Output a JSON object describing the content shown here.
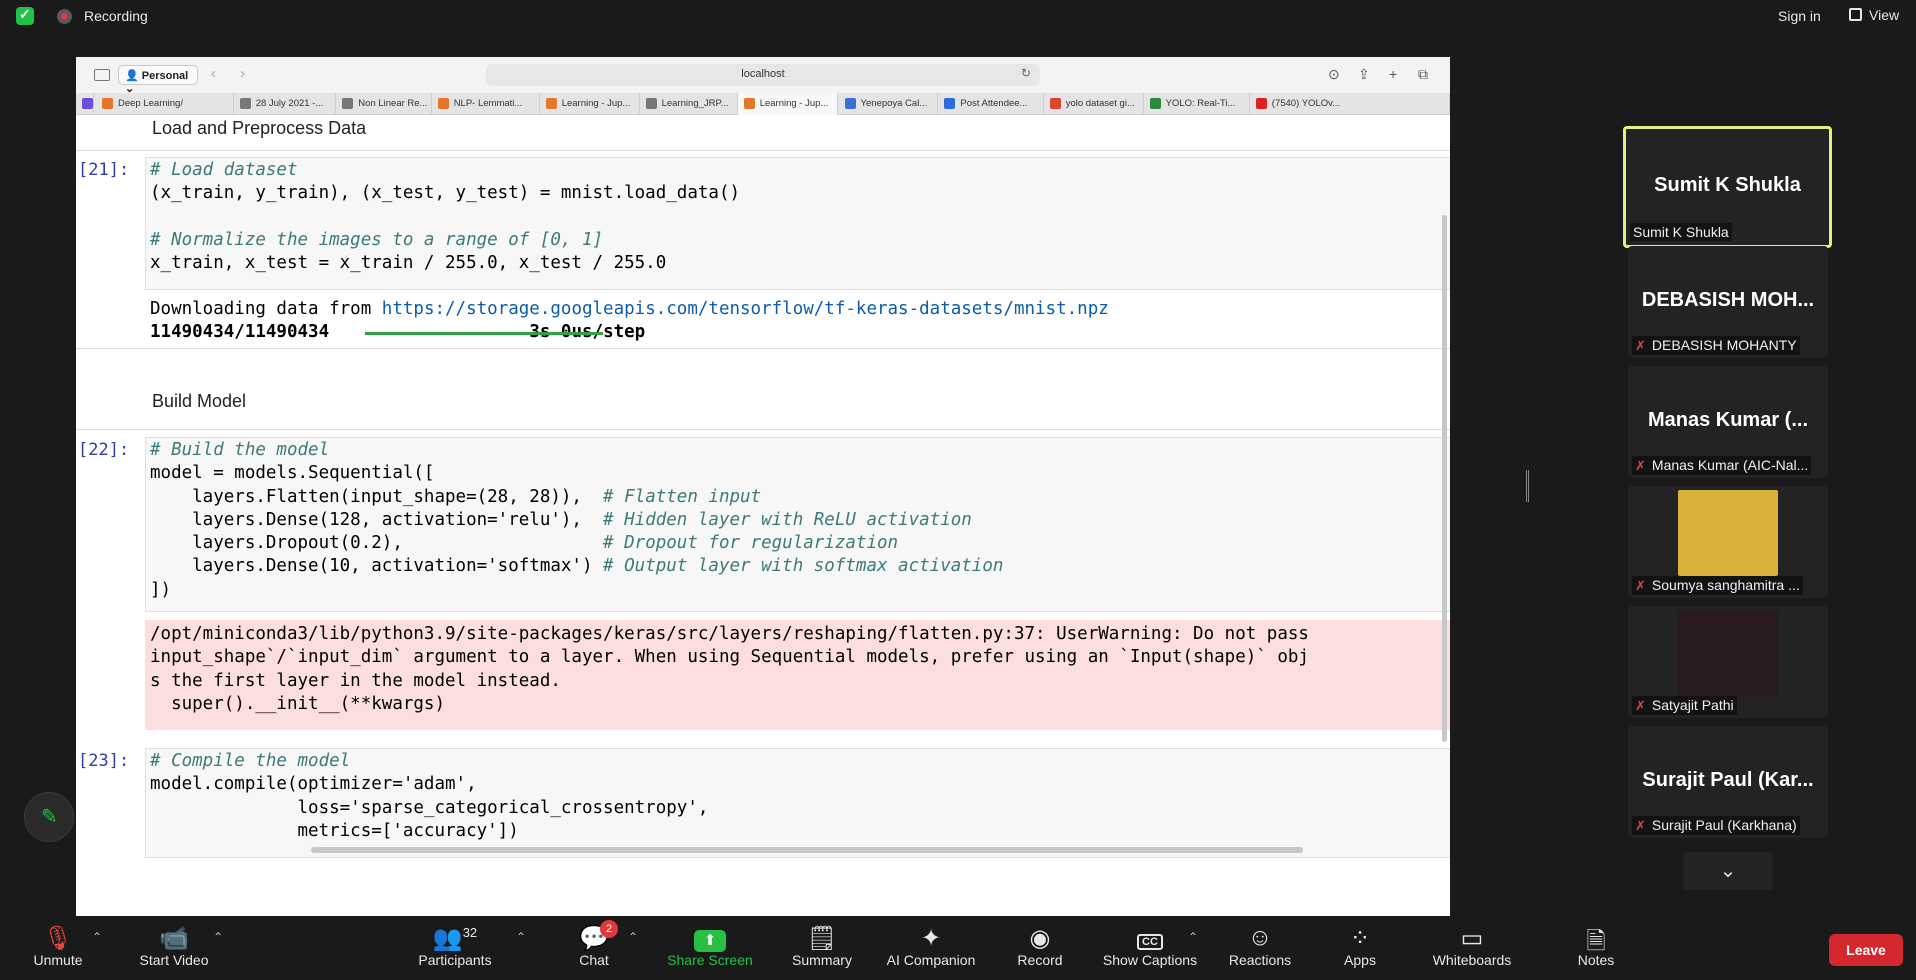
{
  "topbar": {
    "recording_label": "Recording",
    "sign_in": "Sign in",
    "view": "View"
  },
  "browser": {
    "profile": "Personal",
    "url": "localhost",
    "tabs": [
      {
        "label": "Deep Learning/",
        "color": "#e3772a"
      },
      {
        "label": "28 July 2021 -...",
        "color": "#777"
      },
      {
        "label": "Non Linear Re...",
        "color": "#777"
      },
      {
        "label": "NLP- Lemmati...",
        "color": "#e3772a"
      },
      {
        "label": "Learning - Jup...",
        "color": "#e3772a"
      },
      {
        "label": "Learning_JRP...",
        "color": "#777"
      },
      {
        "label": "Learning - Jup...",
        "color": "#e3772a"
      },
      {
        "label": "Yenepoya Cal...",
        "color": "#3a6fd8"
      },
      {
        "label": "Post Attendee...",
        "color": "#2b6de0"
      },
      {
        "label": "yolo dataset gi...",
        "color": "#dd4433"
      },
      {
        "label": "YOLO: Real-Ti...",
        "color": "#2a8a3a"
      },
      {
        "label": "(7540) YOLOv...",
        "color": "#e02020"
      }
    ]
  },
  "notebook": {
    "heading1": "Load and Preprocess Data",
    "cell21_prompt": "[21]:",
    "cell21_line1": "# Load dataset",
    "cell21_line2": "(x_train, y_train), (x_test, y_test) = mnist.load_data()",
    "cell21_line3": "# Normalize the images to a range of [0, 1]",
    "cell21_line4": "x_train, x_test = x_train / 255.0, x_test / 255.0",
    "cell21_out1_prefix": "Downloading data from ",
    "cell21_out1_link": "https://storage.googleapis.com/tensorflow/tf-keras-datasets/mnist.npz",
    "cell21_out2_count": "11490434/11490434",
    "cell21_out2_time": "3s 0us/step",
    "cell21_progress": 1.0,
    "heading2": "Build Model",
    "cell22_prompt": "[22]:",
    "cell22_line1": "# Build the model",
    "cell22_line2": "model = models.Sequential([",
    "cell22_line3a": "    layers.Flatten(input_shape=(28, 28)),  ",
    "cell22_line3b": "# Flatten input",
    "cell22_line4a": "    layers.Dense(128, activation='relu'),  ",
    "cell22_line4b": "# Hidden layer with ReLU activation",
    "cell22_line5a": "    layers.Dropout(0.2),                   ",
    "cell22_line5b": "# Dropout for regularization",
    "cell22_line6a": "    layers.Dense(10, activation='softmax') ",
    "cell22_line6b": "# Output layer with softmax activation",
    "cell22_line7": "])",
    "warn1": "/opt/miniconda3/lib/python3.9/site-packages/keras/src/layers/reshaping/flatten.py:37: UserWarning: Do not pass",
    "warn2": "input_shape`/`input_dim` argument to a layer. When using Sequential models, prefer using an `Input(shape)` obj",
    "warn3": "s the first layer in the model instead.",
    "warn4": "  super().__init__(**kwargs)",
    "cell23_prompt": "[23]:",
    "cell23_line1": "# Compile the model",
    "cell23_line2": "model.compile(optimizer='adam',",
    "cell23_line3": "              loss='sparse_categorical_crossentropy',",
    "cell23_line4": "              metrics=['accuracy'])"
  },
  "participants": [
    {
      "big": "Sumit K Shukla",
      "label": "Sumit K Shukla",
      "muted": false,
      "speaking": true
    },
    {
      "big": "DEBASISH  MOH...",
      "label": "DEBASISH MOHANTY",
      "muted": true
    },
    {
      "big": "Manas Kumar (...",
      "label": "Manas Kumar (AIC-Nal...",
      "muted": true
    },
    {
      "big": "",
      "label": "Soumya sanghamitra ...",
      "muted": true,
      "photo": "#d8b23a"
    },
    {
      "big": "",
      "label": "Satyajit Pathi",
      "muted": true,
      "photo": "#2a1a22"
    },
    {
      "big": "Surajit Paul (Kar...",
      "label": "Surajit Paul (Karkhana)",
      "muted": true
    }
  ],
  "toolbar": {
    "unmute": "Unmute",
    "start_video": "Start Video",
    "participants": "Participants",
    "participants_count": "32",
    "chat": "Chat",
    "chat_badge": "2",
    "share_screen": "Share Screen",
    "summary": "Summary",
    "ai_companion": "AI Companion",
    "record": "Record",
    "show_captions": "Show Captions",
    "reactions": "Reactions",
    "apps": "Apps",
    "whiteboards": "Whiteboards",
    "notes": "Notes",
    "leave": "Leave",
    "cc": "CC"
  },
  "colors": {
    "accent_green": "#27c045",
    "leave_red": "#d4272e",
    "speaker_border": "#e8ee7d"
  }
}
